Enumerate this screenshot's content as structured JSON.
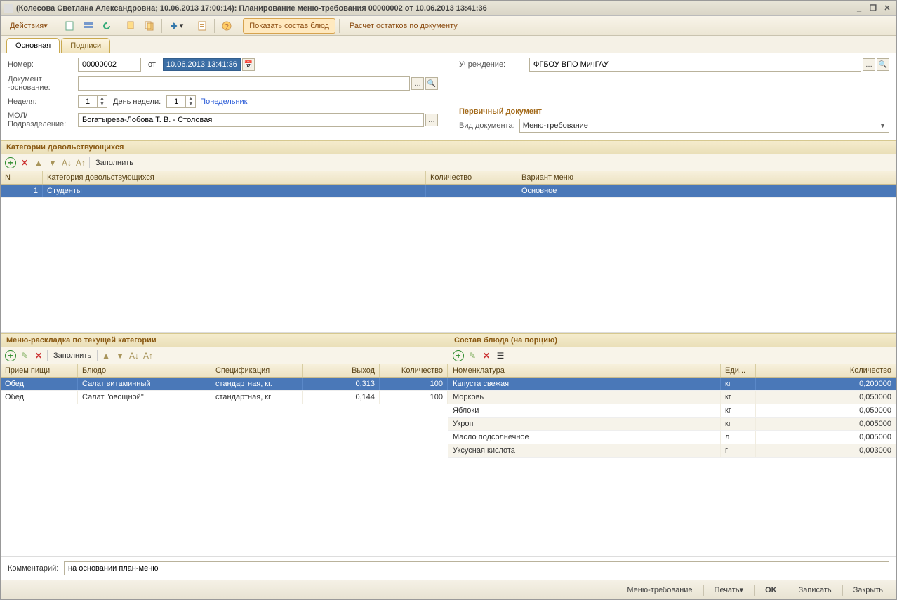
{
  "title": "(Колесова Светлана Александровна; 10.06.2013 17:00:14): Планирование меню-требования 00000002 от 10.06.2013 13:41:36",
  "toolbar": {
    "actions": "Действия",
    "show_composition": "Показать состав блюд",
    "calc_remains": "Расчет остатков по документу"
  },
  "tabs": {
    "main": "Основная",
    "signatures": "Подписи"
  },
  "form": {
    "number_label": "Номер:",
    "number": "00000002",
    "from": "от",
    "date": "10.06.2013 13:41:36",
    "inst_label": "Учреждение:",
    "institution": "ФГБОУ ВПО МичГАУ",
    "docbase_label": "Документ -основание:",
    "week_label": "Неделя:",
    "week": "1",
    "dow_label": "День недели:",
    "dow": "1",
    "dow_name": "Понедельник",
    "dept_label": "МОЛ/ Подразделение:",
    "dept": "Богатырева-Лобова Т. В. - Столовая",
    "primary_doc_header": "Первичный документ",
    "doctype_label": "Вид документа:",
    "doctype": "Меню-требование"
  },
  "cat_section": {
    "title": "Категории довольствующихся",
    "fill": "Заполнить",
    "cols": {
      "n": "N",
      "cat": "Категория довольствующихся",
      "qty": "Количество",
      "variant": "Вариант меню"
    },
    "rows": [
      {
        "n": "1",
        "cat": "Студенты",
        "qty": "",
        "variant": "Основное"
      }
    ]
  },
  "menu_section": {
    "title": "Меню-раскладка по текущей категории",
    "fill": "Заполнить",
    "cols": {
      "meal": "Прием пищи",
      "dish": "Блюдо",
      "spec": "Спецификация",
      "out": "Выход",
      "qty": "Количество"
    },
    "rows": [
      {
        "meal": "Обед",
        "dish": "Салат витаминный",
        "spec": "стандартная, кг.",
        "out": "0,313",
        "qty": "100"
      },
      {
        "meal": "Обед",
        "dish": "Салат \"овощной\"",
        "spec": "стандартная, кг",
        "out": "0,144",
        "qty": "100"
      }
    ]
  },
  "comp_section": {
    "title": "Состав блюда (на порцию)",
    "cols": {
      "nom": "Номенклатура",
      "unit": "Еди...",
      "qty": "Количество"
    },
    "rows": [
      {
        "nom": "Капуста свежая",
        "unit": "кг",
        "qty": "0,200000"
      },
      {
        "nom": "Морковь",
        "unit": "кг",
        "qty": "0,050000"
      },
      {
        "nom": "Яблоки",
        "unit": "кг",
        "qty": "0,050000"
      },
      {
        "nom": "Укроп",
        "unit": "кг",
        "qty": "0,005000"
      },
      {
        "nom": "Масло подсолнечное",
        "unit": "л",
        "qty": "0,005000"
      },
      {
        "nom": "Уксусная кислота",
        "unit": "г",
        "qty": "0,003000"
      }
    ]
  },
  "comment_label": "Комментарий:",
  "comment": "на основании план-меню",
  "footer": {
    "menureq": "Меню-требование",
    "print": "Печать",
    "ok": "OK",
    "save": "Записать",
    "close": "Закрыть"
  }
}
